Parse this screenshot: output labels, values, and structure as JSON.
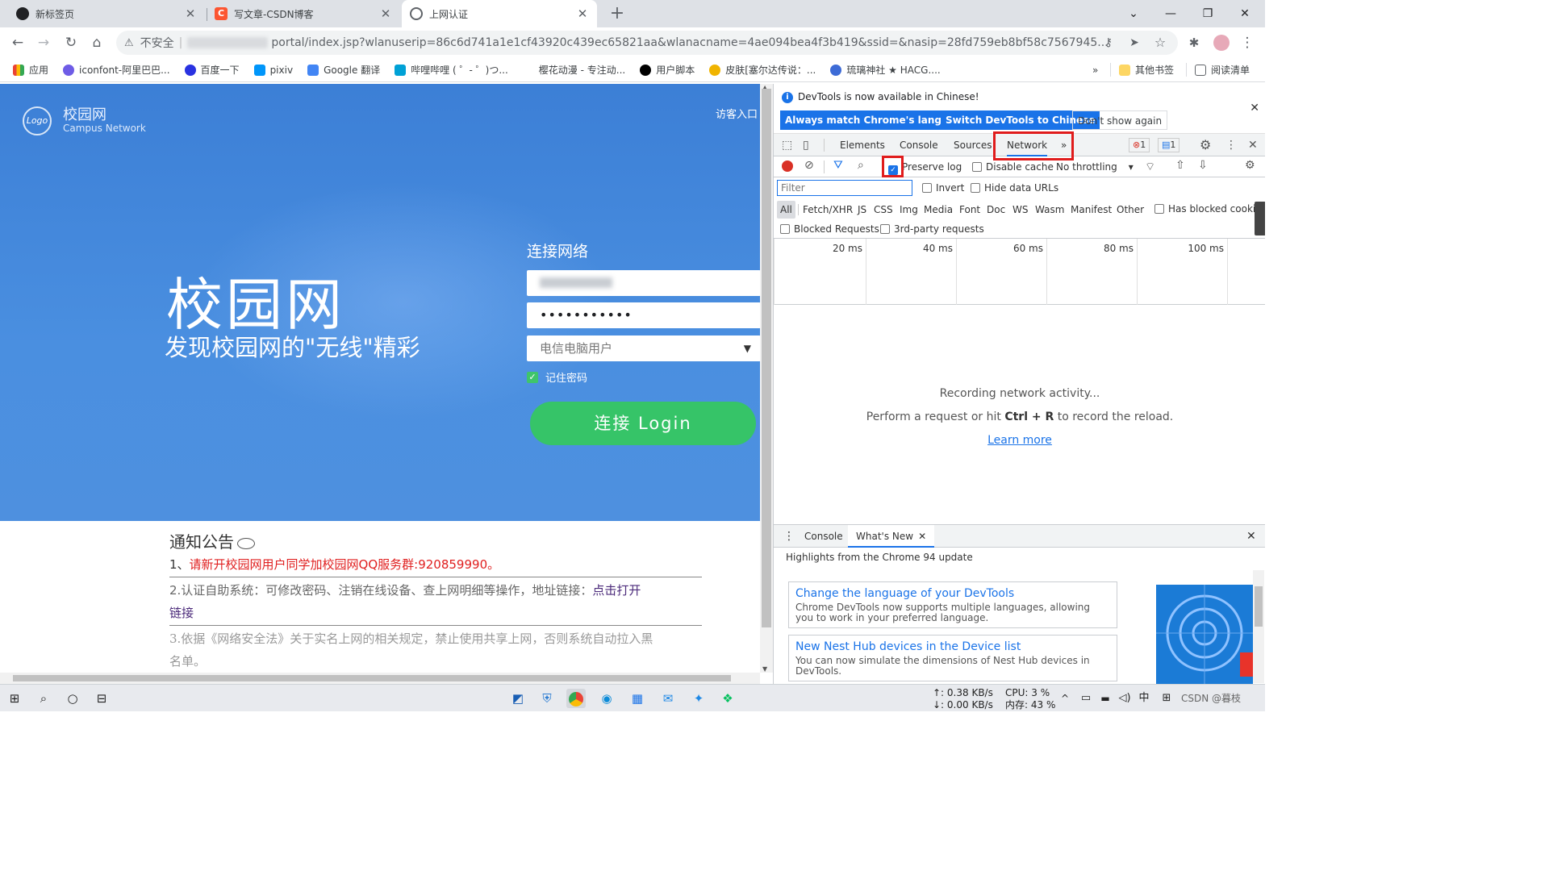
{
  "browser": {
    "tabs": [
      {
        "title": "新标签页",
        "favicon_color": "#202124",
        "close": "✕"
      },
      {
        "title": "写文章-CSDN博客",
        "favicon_color": "#fc5531",
        "favicon_letter": "C",
        "close": "✕"
      },
      {
        "title": "上网认证",
        "favicon_color": "#5f6368",
        "close": "✕"
      }
    ],
    "new_tab": "+",
    "window_controls": {
      "dropdown": "⌄",
      "minimize": "—",
      "restore": "❐",
      "close": "✕"
    },
    "nav": {
      "back": "←",
      "forward": "→",
      "reload": "↻",
      "home": "⌂"
    },
    "omnibox": {
      "security_icon": "⚠",
      "security_label": "不安全",
      "url_visible": "portal/index.jsp?wlanuserip=86c6d741a1e1cf43920c439ec65821aa&wlanacname=4ae094bea4f3b419&ssid=&nasip=28fd759eb8bf58c7567945..."
    },
    "toolbar_icons": [
      "key-icon",
      "send-icon",
      "star-icon",
      "extensions-icon",
      "avatar",
      "menu-icon"
    ],
    "bookmarks": [
      {
        "label": "应用",
        "color": "#ea4335"
      },
      {
        "label": "iconfont-阿里巴巴...",
        "color": "#6e5ce6"
      },
      {
        "label": "百度一下",
        "color": "#2932e1"
      },
      {
        "label": "pixiv",
        "color": "#0096fa"
      },
      {
        "label": "Google 翻译",
        "color": "#4285f4"
      },
      {
        "label": "哔哩哔哩 ( ゜- ゜)つ...",
        "color": "#00a1d6"
      },
      {
        "label": "樱花动漫 - 专注动...",
        "color": "#ffffff"
      },
      {
        "label": "用户脚本",
        "color": "#000000"
      },
      {
        "label": "皮肤[塞尔达传说：...",
        "color": "#f0b400"
      },
      {
        "label": "琉璃神社 ★ HACG....",
        "color": "#3d6bd6"
      }
    ],
    "bookmarks_more": "»",
    "other_bookmarks": "其他书签",
    "reading_list": "阅读清单"
  },
  "portal": {
    "logo_mark": "Logo",
    "logo_title": "校园网",
    "logo_subtitle": "Campus Network",
    "guest_link": "访客入口",
    "hero_title": "校园网",
    "hero_slogan": "发现校园网的\"无线\"精彩",
    "login_heading": "连接网络",
    "password_mask": "•••••••••••",
    "isp_selected": "电信电脑用户",
    "remember_label": "记住密码",
    "remember_checked": true,
    "login_button": "连接 Login",
    "notice_title": "通知公告",
    "notices": {
      "n1_prefix": "1、",
      "n1_text": "请新开校园网用户同学加校园网QQ服务群:920859990。",
      "n2_text": "2.认证自助系统：可修改密码、注销在线设备、查上网明细等操作，地址链接：",
      "n2_link_a": "点击打开",
      "n2_link_b": "链接",
      "n3_text_a": "3.依据《网络安全法》关于实名上网的相关规定，禁止使用共享上网，否则系统自动拉入黑",
      "n3_text_b": "名单。"
    },
    "colors": {
      "hero_blue": "#3c7fd6",
      "login_green": "#36c468",
      "notice_red": "#e02020"
    }
  },
  "devtools": {
    "info_bar": {
      "message": "DevTools is now available in Chinese!",
      "btn_match": "Always match Chrome's language",
      "btn_switch": "Switch DevTools to Chinese",
      "btn_dismiss": "Don't show again",
      "close": "✕"
    },
    "tabs": [
      "Elements",
      "Console",
      "Sources",
      "Network"
    ],
    "active_tab": "Network",
    "more_tabs": "»",
    "errors_badge": "1",
    "messages_badge": "1",
    "network_toolbar": {
      "preserve_log": "Preserve log",
      "preserve_log_checked": true,
      "disable_cache": "Disable cache",
      "throttling": "No throttling"
    },
    "filter": {
      "placeholder": "Filter",
      "invert": "Invert",
      "hide_data_urls": "Hide data URLs",
      "types": [
        "All",
        "Fetch/XHR",
        "JS",
        "CSS",
        "Img",
        "Media",
        "Font",
        "Doc",
        "WS",
        "Wasm",
        "Manifest",
        "Other"
      ],
      "has_blocked_cookies": "Has blocked cookies",
      "blocked_requests": "Blocked Requests",
      "third_party": "3rd-party requests"
    },
    "timeline_ticks": [
      "20 ms",
      "40 ms",
      "60 ms",
      "80 ms",
      "100 ms"
    ],
    "empty_state": {
      "line1": "Recording network activity...",
      "line2_prefix": "Perform a request or hit ",
      "shortcut": "Ctrl + R",
      "line2_suffix": " to record the reload.",
      "learn_more": "Learn more"
    },
    "drawer": {
      "tabs": [
        "Console",
        "What's New"
      ],
      "active_tab": "What's New",
      "tab_close": "✕",
      "heading": "Highlights from the Chrome 94 update",
      "cards": [
        {
          "title": "Change the language of your DevTools",
          "desc": "Chrome DevTools now supports multiple languages, allowing you to work in your preferred language."
        },
        {
          "title": "New Nest Hub devices in the Device list",
          "desc": "You can now simulate the dimensions of Nest Hub devices in DevTools."
        }
      ]
    }
  },
  "taskbar": {
    "net_up": "↑: 0.38 KB/s",
    "net_down": "↓: 0.00 KB/s",
    "cpu": "CPU: 3 %",
    "memory": "内存: 43 %",
    "ime": "中",
    "watermark": "CSDN @暮枝"
  }
}
